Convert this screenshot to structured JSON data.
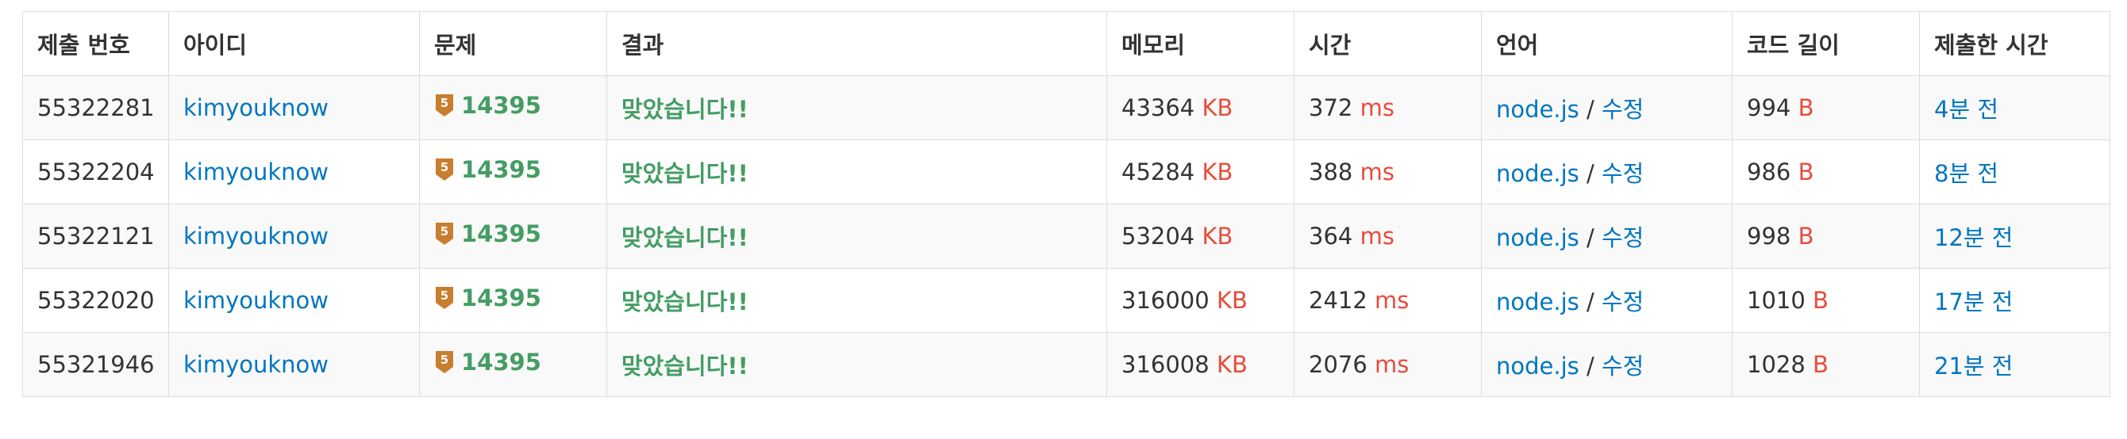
{
  "headers": [
    "제출 번호",
    "아이디",
    "문제",
    "결과",
    "메모리",
    "시간",
    "언어",
    "코드 길이",
    "제출한 시간"
  ],
  "theme": {
    "link": "#0076c0",
    "unit": "#e74c3c",
    "accepted": "#449d64",
    "tier_bronze": "#c97d2e"
  },
  "edit_label": "수정",
  "rows": [
    {
      "id": "55322281",
      "user": "kimyouknow",
      "tier": "5",
      "problem": "14395",
      "result": "맞았습니다!!",
      "memory": "43364",
      "memory_unit": "KB",
      "time": "372",
      "time_unit": "ms",
      "lang": "node.js",
      "code_len": "994",
      "code_unit": "B",
      "submitted": "4분 전"
    },
    {
      "id": "55322204",
      "user": "kimyouknow",
      "tier": "5",
      "problem": "14395",
      "result": "맞았습니다!!",
      "memory": "45284",
      "memory_unit": "KB",
      "time": "388",
      "time_unit": "ms",
      "lang": "node.js",
      "code_len": "986",
      "code_unit": "B",
      "submitted": "8분 전"
    },
    {
      "id": "55322121",
      "user": "kimyouknow",
      "tier": "5",
      "problem": "14395",
      "result": "맞았습니다!!",
      "memory": "53204",
      "memory_unit": "KB",
      "time": "364",
      "time_unit": "ms",
      "lang": "node.js",
      "code_len": "998",
      "code_unit": "B",
      "submitted": "12분 전"
    },
    {
      "id": "55322020",
      "user": "kimyouknow",
      "tier": "5",
      "problem": "14395",
      "result": "맞았습니다!!",
      "memory": "316000",
      "memory_unit": "KB",
      "time": "2412",
      "time_unit": "ms",
      "lang": "node.js",
      "code_len": "1010",
      "code_unit": "B",
      "submitted": "17분 전"
    },
    {
      "id": "55321946",
      "user": "kimyouknow",
      "tier": "5",
      "problem": "14395",
      "result": "맞았습니다!!",
      "memory": "316008",
      "memory_unit": "KB",
      "time": "2076",
      "time_unit": "ms",
      "lang": "node.js",
      "code_len": "1028",
      "code_unit": "B",
      "submitted": "21분 전"
    }
  ]
}
